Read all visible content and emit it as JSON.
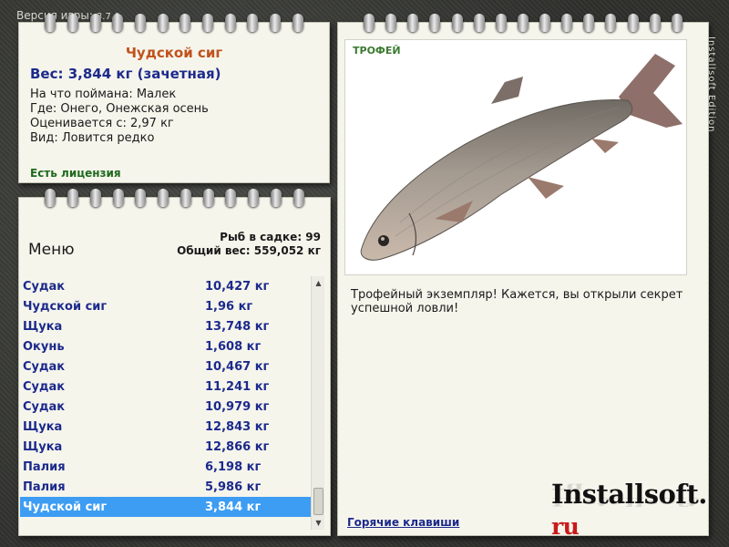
{
  "version": {
    "label": "Версия игры:",
    "number": "3.7.6"
  },
  "fish": {
    "name": "Чудской сиг",
    "weight": "Вес: 3,844 кг (зачетная)",
    "caught_on": "На что поймана: Малек",
    "where": "Где: Онего, Онежская осень",
    "estimated": "Оценивается с: 2,97 кг",
    "kind": "Вид: Ловится редко",
    "license": "Есть лицензия"
  },
  "list": {
    "menu_label": "Меню",
    "fish_count": "Рыб в садке: 99",
    "total_weight": "Общий вес: 559,052 кг",
    "rows": [
      {
        "name": "Судак",
        "weight": "10,427 кг"
      },
      {
        "name": "Чудской сиг",
        "weight": "1,96 кг"
      },
      {
        "name": "Щука",
        "weight": "13,748 кг"
      },
      {
        "name": "Окунь",
        "weight": "1,608 кг"
      },
      {
        "name": "Судак",
        "weight": "10,467 кг"
      },
      {
        "name": "Судак",
        "weight": "11,241 кг"
      },
      {
        "name": "Судак",
        "weight": "10,979 кг"
      },
      {
        "name": "Щука",
        "weight": "12,843 кг"
      },
      {
        "name": "Щука",
        "weight": "12,866 кг"
      },
      {
        "name": "Палия",
        "weight": "6,198 кг"
      },
      {
        "name": "Палия",
        "weight": "5,986 кг"
      },
      {
        "name": "Чудской сиг",
        "weight": "3,844 кг"
      }
    ],
    "selected_index": 11
  },
  "trophy": {
    "label": "ТРОФЕЙ",
    "text": "Трофейный экземпляр! Кажется, вы открыли секрет успешной ловли!",
    "hotkeys": "Горячие клавиши"
  },
  "brand": {
    "name": "Installsoft.",
    "tld": "ru",
    "edition": "Installsoft Edition"
  },
  "colors": {
    "accent_blue": "#1c2a8c",
    "selection": "#3d9df3",
    "title_orange": "#c0521c",
    "license_green": "#1e6a1e"
  }
}
